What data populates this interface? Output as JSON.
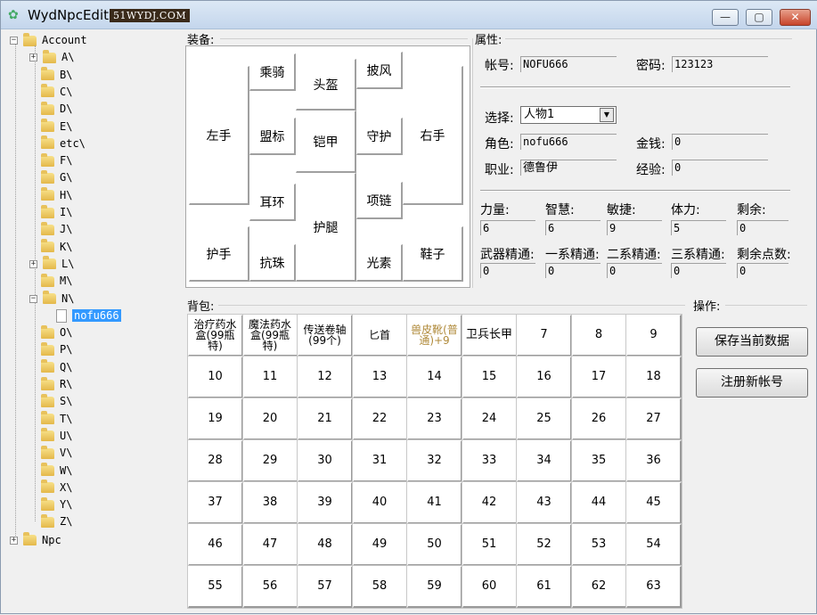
{
  "window": {
    "title": "WydNpcEdit",
    "watermark": "51WYDJ.COM",
    "min_label": "—",
    "max_label": "▢",
    "close_label": "✕"
  },
  "tree": {
    "root": "Account",
    "folders": [
      "A\\",
      "B\\",
      "C\\",
      "D\\",
      "E\\",
      "etc\\",
      "F\\",
      "G\\",
      "H\\",
      "I\\",
      "J\\",
      "K\\",
      "L\\",
      "M\\",
      "N\\"
    ],
    "selected_child": "nofu666",
    "folders_after": [
      "O\\",
      "P\\",
      "Q\\",
      "R\\",
      "S\\",
      "T\\",
      "U\\",
      "V\\",
      "W\\",
      "X\\",
      "Y\\",
      "Z\\"
    ],
    "npc": "Npc"
  },
  "equip": {
    "group_label": "装备:",
    "left_hand": "左手",
    "mount": "乘骑",
    "helmet": "头盔",
    "cape": "披风",
    "right_hand": "右手",
    "emblem": "盟标",
    "armor": "铠甲",
    "guard": "守护",
    "earring": "耳环",
    "necklace": "项链",
    "gauntlet": "护手",
    "leggings": "护腿",
    "shoes": "鞋子",
    "orb": "抗珠",
    "element": "光素"
  },
  "attributes": {
    "group_label": "属性:",
    "account_label": "帐号:",
    "account_value": "NOFU666",
    "password_label": "密码:",
    "password_value": "123123",
    "select_label": "选择:",
    "select_value": "人物1",
    "role_label": "角色:",
    "role_value": "nofu666",
    "money_label": "金钱:",
    "money_value": "0",
    "job_label": "职业:",
    "job_value": "德鲁伊",
    "exp_label": "经验:",
    "exp_value": "0",
    "stats": [
      {
        "label": "力量:",
        "value": "6"
      },
      {
        "label": "智慧:",
        "value": "6"
      },
      {
        "label": "敏捷:",
        "value": "9"
      },
      {
        "label": "体力:",
        "value": "5"
      },
      {
        "label": "剩余:",
        "value": "0"
      }
    ],
    "masteries": [
      {
        "label": "武器精通:",
        "value": "0"
      },
      {
        "label": "一系精通:",
        "value": "0"
      },
      {
        "label": "二系精通:",
        "value": "0"
      },
      {
        "label": "三系精通:",
        "value": "0"
      },
      {
        "label": "剩余点数:",
        "value": "0"
      }
    ]
  },
  "bag": {
    "group_label": "背包:",
    "cells": [
      "治疗药水盒(99瓶特)",
      "魔法药水盒(99瓶特)",
      "传送卷轴(99个)",
      "匕首",
      "兽皮靴(普通)+9",
      "卫兵长甲",
      "7",
      "8",
      "9",
      "10",
      "11",
      "12",
      "13",
      "14",
      "15",
      "16",
      "17",
      "18",
      "19",
      "20",
      "21",
      "22",
      "23",
      "24",
      "25",
      "26",
      "27",
      "28",
      "29",
      "30",
      "31",
      "32",
      "33",
      "34",
      "35",
      "36",
      "37",
      "38",
      "39",
      "40",
      "41",
      "42",
      "43",
      "44",
      "45",
      "46",
      "47",
      "48",
      "49",
      "50",
      "51",
      "52",
      "53",
      "54",
      "55",
      "56",
      "57",
      "58",
      "59",
      "60",
      "61",
      "62",
      "63"
    ]
  },
  "operations": {
    "group_label": "操作:",
    "save_label": "保存当前数据",
    "register_label": "注册新帐号"
  }
}
